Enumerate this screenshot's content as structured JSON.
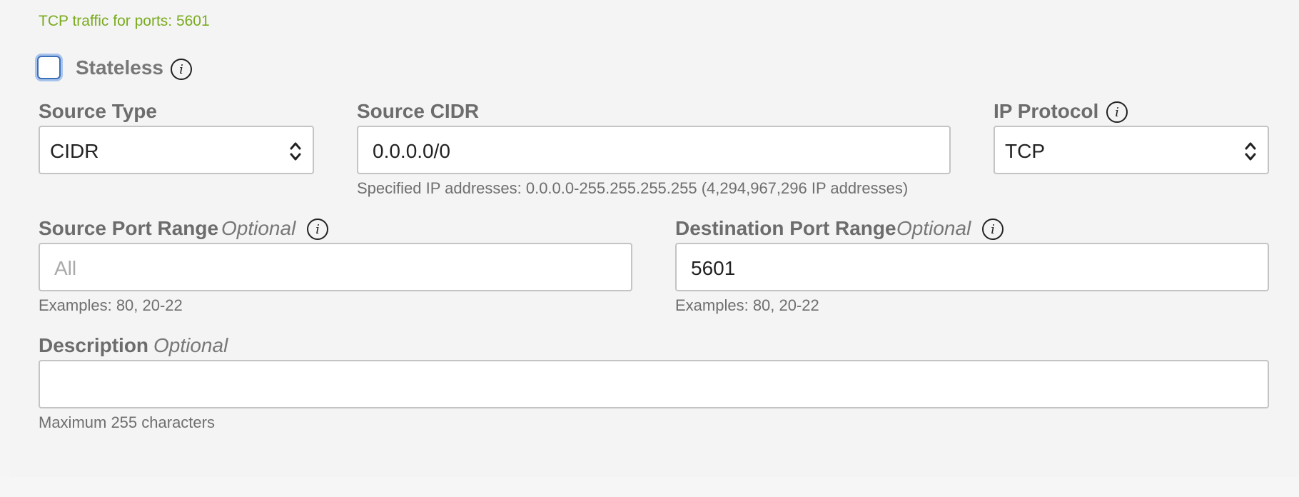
{
  "traffic_note": "TCP traffic for ports: 5601",
  "stateless": {
    "label": "Stateless",
    "checked": false
  },
  "source_type": {
    "label": "Source Type",
    "value": "CIDR"
  },
  "source_cidr": {
    "label": "Source CIDR",
    "value": "0.0.0.0/0",
    "hint": "Specified IP addresses: 0.0.0.0-255.255.255.255 (4,294,967,296 IP addresses)"
  },
  "ip_protocol": {
    "label": "IP Protocol",
    "value": "TCP"
  },
  "source_port_range": {
    "label": "Source Port Range",
    "optional": "Optional",
    "placeholder": "All",
    "value": "",
    "hint": "Examples: 80, 20-22"
  },
  "destination_port_range": {
    "label": "Destination Port Range",
    "optional": "Optional",
    "value": "5601",
    "hint": "Examples: 80, 20-22"
  },
  "description": {
    "label": "Description",
    "optional": "Optional",
    "value": "",
    "hint": "Maximum 255 characters"
  },
  "icons": {
    "info": "info-icon",
    "select_arrows": "chevron-up-down-icon"
  },
  "colors": {
    "accent_green": "#7aab1e",
    "checkbox_focus": "#3d6fb8"
  }
}
